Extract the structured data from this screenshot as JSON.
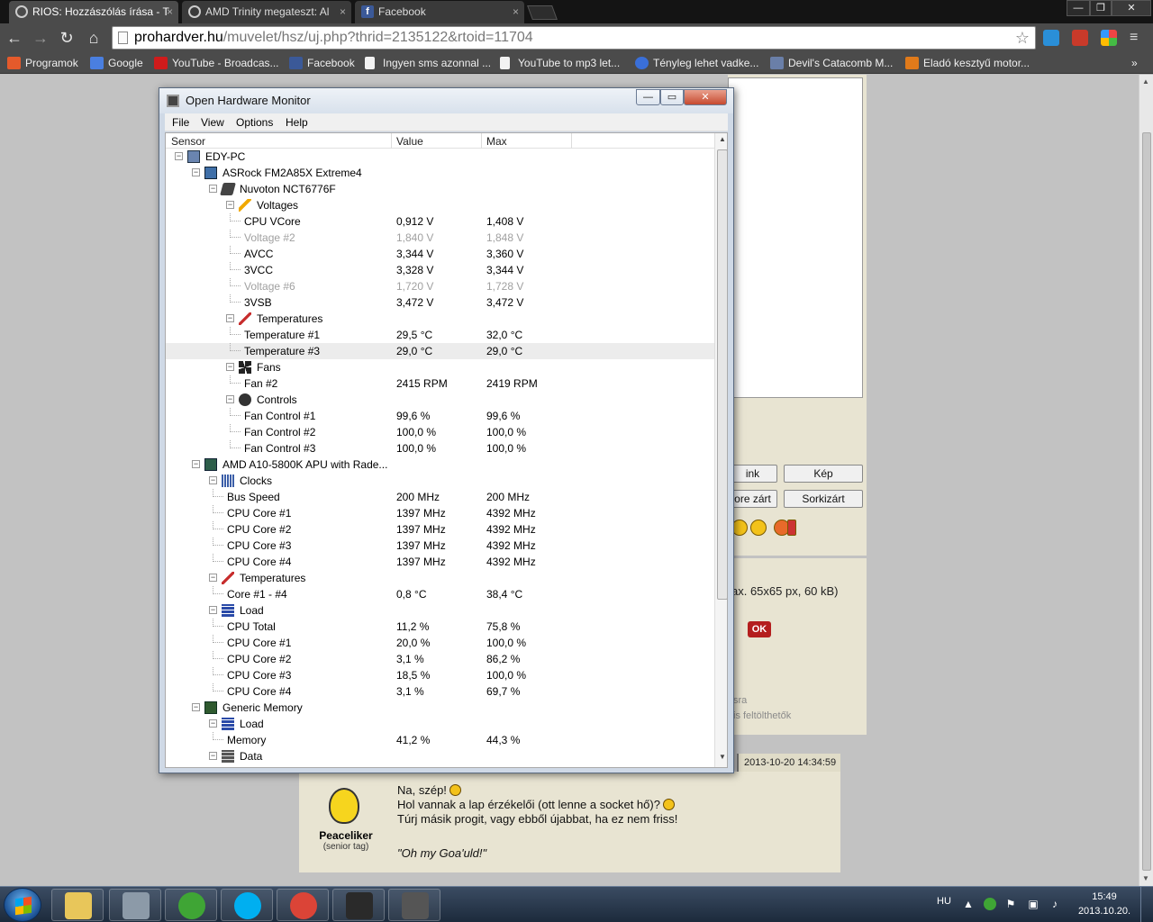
{
  "browser": {
    "tabs": [
      {
        "label": "RIOS: Hozzászólás írása - T"
      },
      {
        "label": "AMD Trinity megateszt: Al"
      },
      {
        "label": "Facebook"
      }
    ],
    "tab_close": "×",
    "window_buttons": {
      "minimize": "—",
      "maximize": "❐",
      "close": "✕"
    },
    "nav": {
      "back": "←",
      "forward": "→",
      "reload": "↻",
      "home": "⌂"
    },
    "url_host": "prohardver.hu",
    "url_path": "/muvelet/hsz/uj.php?thrid=2135122&rtoid=11704",
    "star": "☆",
    "bookmarks": [
      {
        "label": "Programok",
        "icon": "apps-grid-icon",
        "color": "#e55a2b"
      },
      {
        "label": "Google",
        "icon": "google-icon",
        "color": "#4a7fe0"
      },
      {
        "label": "YouTube - Broadcas...",
        "icon": "youtube-icon",
        "color": "#d01b1b"
      },
      {
        "label": "Facebook",
        "icon": "facebook-icon",
        "color": "#3b5998"
      },
      {
        "label": "Ingyen sms azonnal ...",
        "icon": "page-icon",
        "color": "#f2f2f2"
      },
      {
        "label": "YouTube to mp3 let...",
        "icon": "page-icon",
        "color": "#f2f2f2"
      },
      {
        "label": "Tényleg lehet vadke...",
        "icon": "question-icon",
        "color": "#3a6fd8"
      },
      {
        "label": "Devil's Catacomb M...",
        "icon": "site-icon",
        "color": "#6a7fa8"
      },
      {
        "label": "Eladó kesztyű motor...",
        "icon": "site-icon",
        "color": "#e07a1a"
      }
    ],
    "bookmarks_more": "»"
  },
  "page": {
    "buttons": {
      "link": "ink",
      "image": "Kép",
      "wrap": "ore zárt",
      "linebreak": "Sorkizárt"
    },
    "avatar_note": "ax. 65x65 px, 60 kB)",
    "ok": "OK",
    "gray1": "sra",
    "gray2": "is feltölthetők",
    "post_time": "2013-10-20 14:34:59",
    "post_user": "Peaceliker",
    "post_rank": "(senior tag)",
    "post_line1": "Na, szép!",
    "post_line2": "Hol vannak a lap érzékelői (ott lenne a socket hő)?",
    "post_line3": "Túrj másik progit, vagy ebből újabbat, ha ez nem friss!",
    "post_sig": "\"Oh my Goa'uld!\""
  },
  "ohm": {
    "title": "Open Hardware Monitor",
    "caption": {
      "minimize": "—",
      "maximize": "▭",
      "close": "✕"
    },
    "menu": [
      "File",
      "View",
      "Options",
      "Help"
    ],
    "columns": {
      "sensor": "Sensor",
      "value": "Value",
      "max": "Max"
    },
    "rows": [
      {
        "depth": 0,
        "exp": "−",
        "icon": "computer-icon",
        "label": "EDY-PC",
        "value": "",
        "max": ""
      },
      {
        "depth": 1,
        "exp": "−",
        "icon": "motherboard-icon",
        "label": "ASRock FM2A85X Extreme4",
        "value": "",
        "max": ""
      },
      {
        "depth": 2,
        "exp": "−",
        "icon": "chip-icon",
        "label": "Nuvoton NCT6776F",
        "value": "",
        "max": ""
      },
      {
        "depth": 3,
        "exp": "−",
        "icon": "voltage-icon",
        "label": "Voltages",
        "value": "",
        "max": ""
      },
      {
        "depth": 4,
        "exp": "",
        "icon": "",
        "label": "CPU VCore",
        "value": "0,912 V",
        "max": "1,408 V"
      },
      {
        "depth": 4,
        "exp": "",
        "icon": "",
        "label": "Voltage #2",
        "value": "1,840 V",
        "max": "1,848 V",
        "dim": true
      },
      {
        "depth": 4,
        "exp": "",
        "icon": "",
        "label": "AVCC",
        "value": "3,344 V",
        "max": "3,360 V"
      },
      {
        "depth": 4,
        "exp": "",
        "icon": "",
        "label": "3VCC",
        "value": "3,328 V",
        "max": "3,344 V"
      },
      {
        "depth": 4,
        "exp": "",
        "icon": "",
        "label": "Voltage #6",
        "value": "1,720 V",
        "max": "1,728 V",
        "dim": true
      },
      {
        "depth": 4,
        "exp": "",
        "icon": "",
        "label": "3VSB",
        "value": "3,472 V",
        "max": "3,472 V"
      },
      {
        "depth": 3,
        "exp": "−",
        "icon": "thermometer-icon",
        "label": "Temperatures",
        "value": "",
        "max": ""
      },
      {
        "depth": 4,
        "exp": "",
        "icon": "",
        "label": "Temperature #1",
        "value": "29,5 °C",
        "max": "32,0 °C"
      },
      {
        "depth": 4,
        "exp": "",
        "icon": "",
        "label": "Temperature #3",
        "value": "29,0 °C",
        "max": "29,0 °C",
        "sel": true
      },
      {
        "depth": 3,
        "exp": "−",
        "icon": "fan-icon",
        "label": "Fans",
        "value": "",
        "max": ""
      },
      {
        "depth": 4,
        "exp": "",
        "icon": "",
        "label": "Fan #2",
        "value": "2415 RPM",
        "max": "2419 RPM"
      },
      {
        "depth": 3,
        "exp": "−",
        "icon": "control-knob-icon",
        "label": "Controls",
        "value": "",
        "max": ""
      },
      {
        "depth": 4,
        "exp": "",
        "icon": "",
        "label": "Fan Control #1",
        "value": "99,6 %",
        "max": "99,6 %"
      },
      {
        "depth": 4,
        "exp": "",
        "icon": "",
        "label": "Fan Control #2",
        "value": "100,0 %",
        "max": "100,0 %"
      },
      {
        "depth": 4,
        "exp": "",
        "icon": "",
        "label": "Fan Control #3",
        "value": "100,0 %",
        "max": "100,0 %"
      },
      {
        "depth": 1,
        "exp": "−",
        "icon": "cpu-icon",
        "label": "AMD A10-5800K APU with Rade...",
        "value": "",
        "max": ""
      },
      {
        "depth": 2,
        "exp": "−",
        "icon": "clock-bars-icon",
        "label": "Clocks",
        "value": "",
        "max": ""
      },
      {
        "depth": 3,
        "exp": "",
        "icon": "",
        "label": "Bus Speed",
        "value": "200 MHz",
        "max": "200 MHz"
      },
      {
        "depth": 3,
        "exp": "",
        "icon": "",
        "label": "CPU Core #1",
        "value": "1397 MHz",
        "max": "4392 MHz"
      },
      {
        "depth": 3,
        "exp": "",
        "icon": "",
        "label": "CPU Core #2",
        "value": "1397 MHz",
        "max": "4392 MHz"
      },
      {
        "depth": 3,
        "exp": "",
        "icon": "",
        "label": "CPU Core #3",
        "value": "1397 MHz",
        "max": "4392 MHz"
      },
      {
        "depth": 3,
        "exp": "",
        "icon": "",
        "label": "CPU Core #4",
        "value": "1397 MHz",
        "max": "4392 MHz"
      },
      {
        "depth": 2,
        "exp": "−",
        "icon": "thermometer-icon",
        "label": "Temperatures",
        "value": "",
        "max": ""
      },
      {
        "depth": 3,
        "exp": "",
        "icon": "",
        "label": "Core #1 - #4",
        "value": "0,8 °C",
        "max": "38,4 °C"
      },
      {
        "depth": 2,
        "exp": "−",
        "icon": "load-bars-icon",
        "label": "Load",
        "value": "",
        "max": ""
      },
      {
        "depth": 3,
        "exp": "",
        "icon": "",
        "label": "CPU Total",
        "value": "11,2 %",
        "max": "75,8 %"
      },
      {
        "depth": 3,
        "exp": "",
        "icon": "",
        "label": "CPU Core #1",
        "value": "20,0 %",
        "max": "100,0 %"
      },
      {
        "depth": 3,
        "exp": "",
        "icon": "",
        "label": "CPU Core #2",
        "value": "3,1 %",
        "max": "86,2 %"
      },
      {
        "depth": 3,
        "exp": "",
        "icon": "",
        "label": "CPU Core #3",
        "value": "18,5 %",
        "max": "100,0 %"
      },
      {
        "depth": 3,
        "exp": "",
        "icon": "",
        "label": "CPU Core #4",
        "value": "3,1 %",
        "max": "69,7 %"
      },
      {
        "depth": 1,
        "exp": "−",
        "icon": "memory-icon",
        "label": "Generic Memory",
        "value": "",
        "max": ""
      },
      {
        "depth": 2,
        "exp": "−",
        "icon": "load-bars-icon",
        "label": "Load",
        "value": "",
        "max": ""
      },
      {
        "depth": 3,
        "exp": "",
        "icon": "",
        "label": "Memory",
        "value": "41,2 %",
        "max": "44,3 %"
      },
      {
        "depth": 2,
        "exp": "−",
        "icon": "data-icon",
        "label": "Data",
        "value": "",
        "max": ""
      }
    ]
  },
  "taskbar": {
    "apps": [
      {
        "name": "explorer-taskbar-button",
        "icon": "folder-icon",
        "color": "#e8c65a"
      },
      {
        "name": "cpu-tool-taskbar-button",
        "icon": "monitor-icon",
        "color": "#8c9aa8"
      },
      {
        "name": "utorrent-taskbar-button",
        "icon": "utorrent-icon",
        "color": "#3fa535"
      },
      {
        "name": "skype-taskbar-button",
        "icon": "skype-icon",
        "color": "#00aff0"
      },
      {
        "name": "chrome-taskbar-button",
        "icon": "chrome-icon",
        "color": "#db4437"
      },
      {
        "name": "skyrim-taskbar-button",
        "icon": "skyrim-icon",
        "color": "#2a2a2a"
      },
      {
        "name": "ohm-taskbar-button",
        "icon": "hardware-monitor-icon",
        "color": "#555555"
      }
    ],
    "lang": "HU",
    "time": "15:49",
    "date": "2013.10.20."
  }
}
